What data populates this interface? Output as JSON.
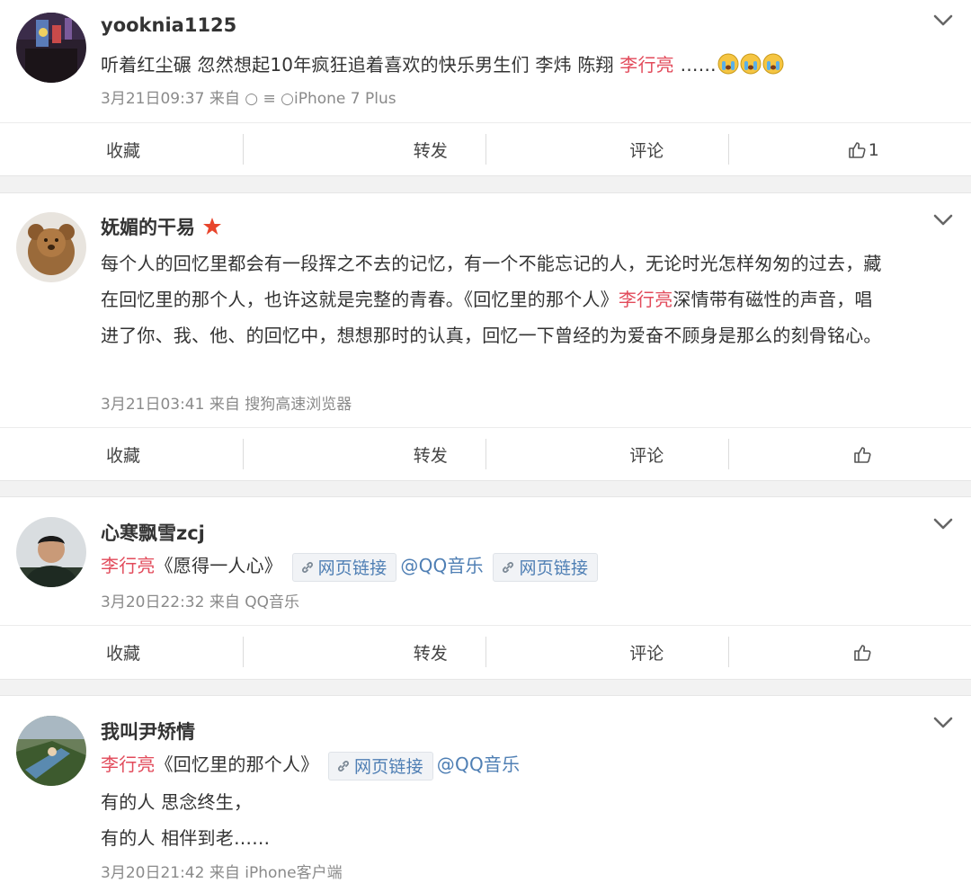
{
  "actions": {
    "favorite": "收藏",
    "repost": "转发",
    "comment": "评论"
  },
  "posts": [
    {
      "username": "yooknia1125",
      "lines": [
        {
          "pre": "听着红尘碾 忽然想起10年疯狂追着喜欢的快乐男生们 李炜 陈翔 ",
          "mention": "李行亮",
          "post": " ……"
        }
      ],
      "emoji_icons": [
        "crying-face-icon",
        "crying-face-icon",
        "crying-face-icon"
      ],
      "meta": "3月21日09:37 来自 ○ ≡ ○iPhone 7 Plus",
      "like_count": "1"
    },
    {
      "username": "妩媚的干易",
      "badge_icon": "star-badge-icon",
      "lines": [
        "每个人的回忆里都会有一段挥之不去的记忆，有一个不能忘记的人，无论时光怎样匆匆的过去，藏",
        {
          "pre": "在回忆里的那个人，也许这就是完整的青春。《回忆里的那个人》",
          "mention": "李行亮",
          "post": "深情带有磁性的声音，唱"
        },
        "进了你、我、他、的回忆中，想想那时的认真，回忆一下曾经的为爱奋不顾身是那么的刻骨铭心。"
      ],
      "meta": "3月21日03:41 来自 搜狗高速浏览器",
      "like_count": ""
    },
    {
      "username": "心寒飘雪zcj",
      "mention": "李行亮",
      "song": "《愿得一人心》",
      "link_label": "网页链接",
      "at_label": "@QQ音乐",
      "link_label_2": "网页链接",
      "meta": "3月20日22:32 来自 QQ音乐",
      "like_count": ""
    },
    {
      "username": "我叫尹矫情",
      "mention": "李行亮",
      "song": "《回忆里的那个人》",
      "link_label": "网页链接",
      "at_label": "@QQ音乐",
      "line2": "有的人 思念终生，",
      "line3": "有的人 相伴到老……",
      "meta": "3月20日21:42 来自 iPhone客户端"
    }
  ],
  "colors": {
    "mention": "#e24a5a",
    "link": "#4f7fb4",
    "meta": "#8a8a8a",
    "background": "#f2f2f2"
  }
}
